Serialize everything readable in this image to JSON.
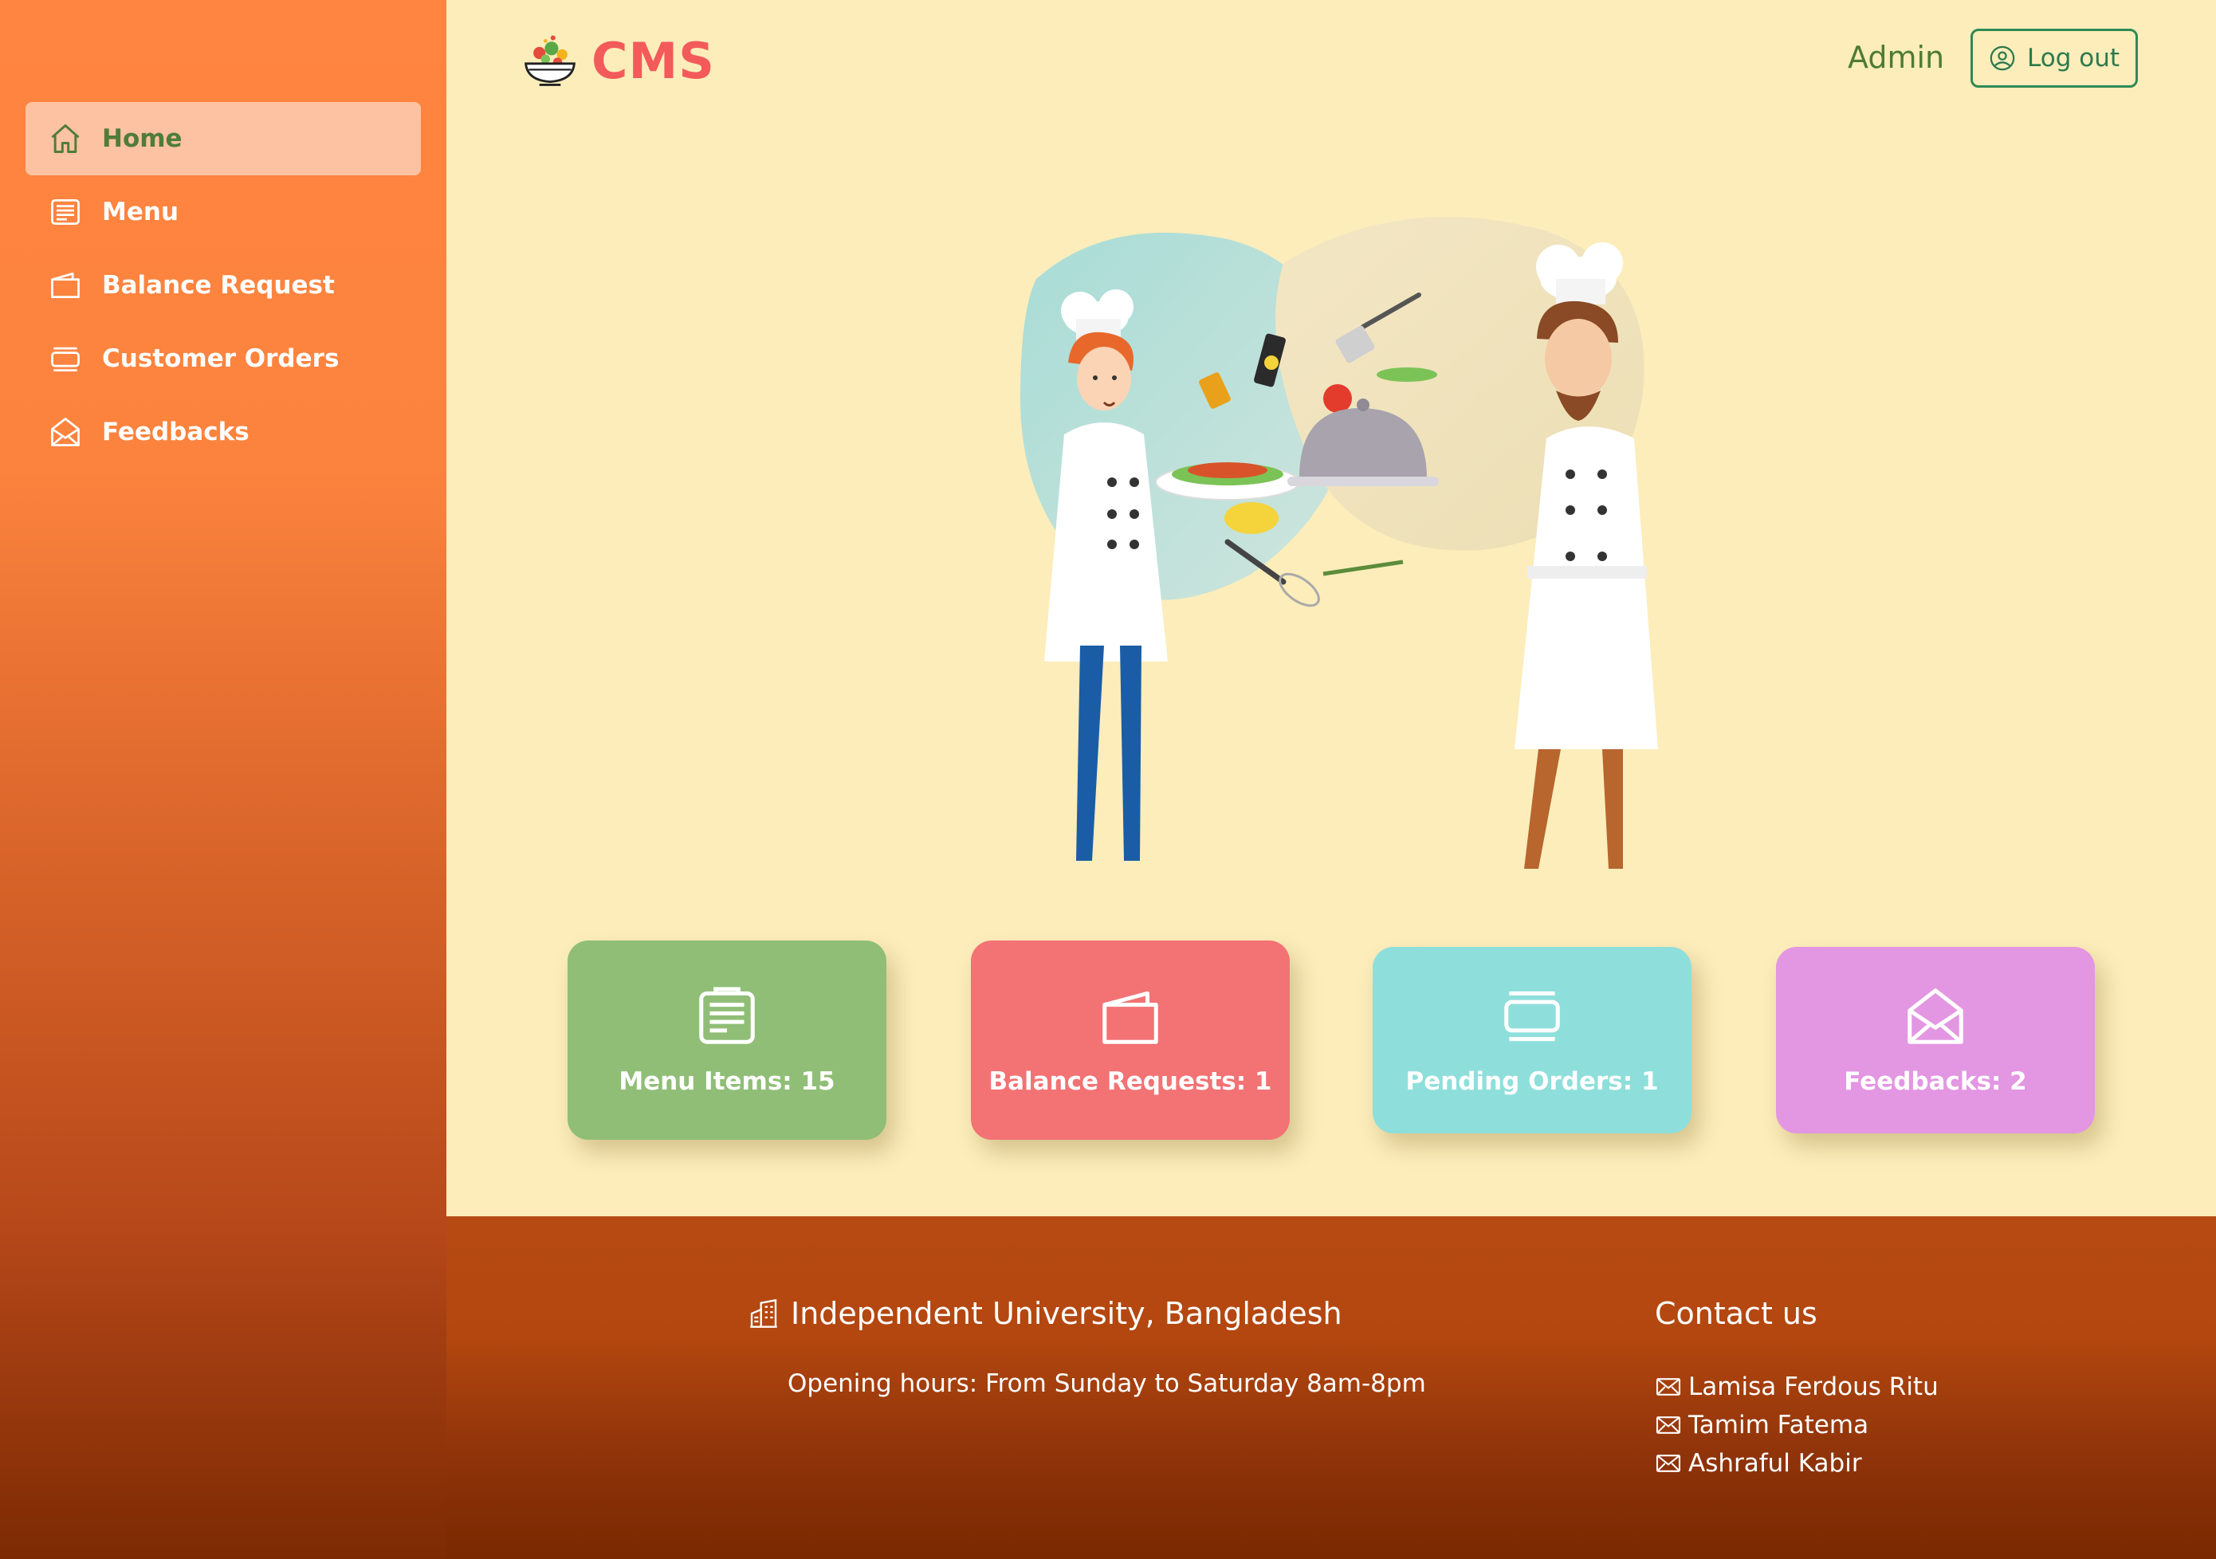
{
  "app": {
    "name": "CMS",
    "user": "Admin",
    "logout_label": "Log out"
  },
  "sidebar": {
    "items": [
      {
        "label": "Home",
        "icon": "home-icon",
        "active": true
      },
      {
        "label": "Menu",
        "icon": "menu-list-icon",
        "active": false
      },
      {
        "label": "Balance Request",
        "icon": "wallet-icon",
        "active": false
      },
      {
        "label": "Customer Orders",
        "icon": "orders-icon",
        "active": false
      },
      {
        "label": "Feedbacks",
        "icon": "envelope-open-icon",
        "active": false
      }
    ]
  },
  "stats": {
    "menu_items": "Menu Items: 15",
    "balance_requests": "Balance Requests: 1",
    "pending_orders": "Pending Orders: 1",
    "feedbacks": "Feedbacks: 2"
  },
  "footer": {
    "organization": "Independent University, Bangladesh",
    "hours": "Opening hours: From Sunday to Saturday 8am-8pm",
    "contact_title": "Contact us",
    "contacts": [
      "Lamisa Ferdous Ritu",
      "Tamim Fatema",
      "Ashraful Kabir"
    ]
  },
  "colors": {
    "sidebar_top": "#ff8540",
    "page_background": "#fcedbb",
    "brand": "#f35a5a",
    "accent_green": "#4d7c34",
    "card_menu": "#90be77",
    "card_balance": "#f37274",
    "card_pending": "#8edfdb",
    "card_feedback": "#e396e2",
    "footer": "#b3470f"
  }
}
